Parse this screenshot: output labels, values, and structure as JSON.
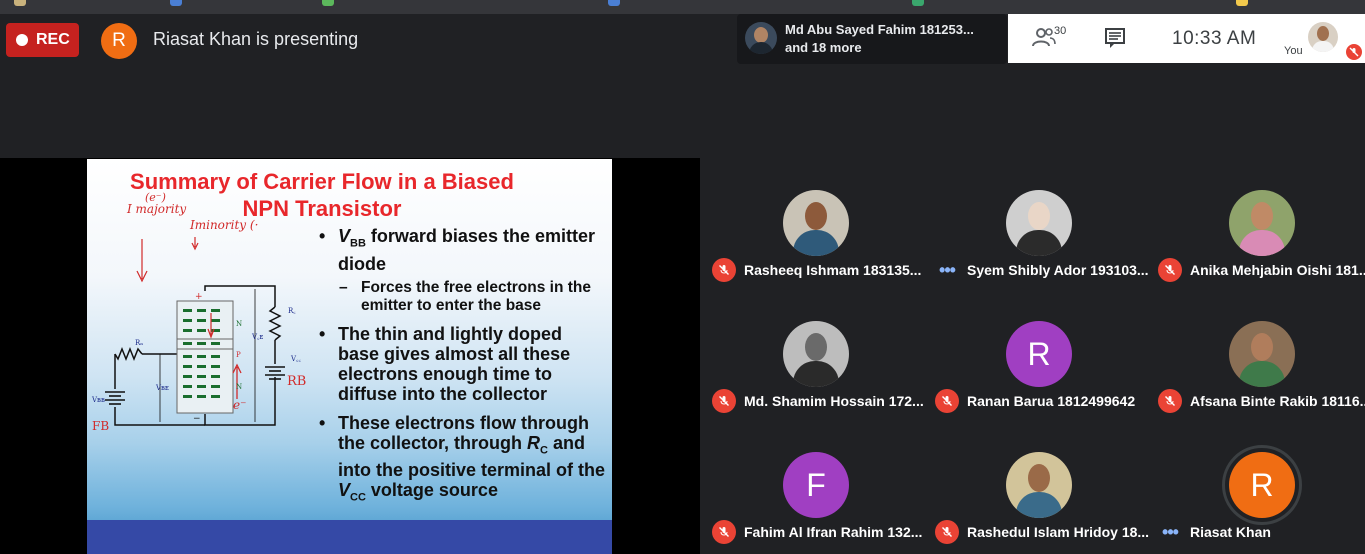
{
  "recording": {
    "label": "REC"
  },
  "presenter": {
    "initial": "R",
    "text": "Riasat Khan is presenting"
  },
  "attendee_chip": {
    "line1": "Md Abu Sayed Fahim 181253...",
    "line2": "and 18 more"
  },
  "toolbar": {
    "people_count": "30",
    "time": "10:33  AM",
    "you_label": "You"
  },
  "slide": {
    "title_line1": "Summary of Carrier Flow in a Biased",
    "title_line2": "NPN Transistor",
    "bullets": [
      {
        "pre": "",
        "sym": "V",
        "sub": "BB",
        "text": " forward biases the emitter diode"
      },
      {
        "text": "The thin and lightly doped base gives almost all these electrons enough time to diffuse into the collector"
      },
      {
        "text_a": "These electrons flow through the collector, through ",
        "sym": "R",
        "sub": "C",
        "text_b": " and into the positive terminal of the ",
        "sym2": "V",
        "sub2": "CC",
        "text_c": " voltage source"
      }
    ],
    "sub_bullet": "Forces the free electrons in the emitter to enter the base",
    "annotations": {
      "e": "(e⁻)",
      "i_majority": "I majority",
      "i_minority": "Iminority (·",
      "fb": "FB",
      "rb": "RB",
      "e_minus": "e⁻"
    },
    "circuit_labels": {
      "plus": "+",
      "minus": "−",
      "n_top": "N",
      "p": "P",
      "n_bot": "N",
      "rb": "Rₙ",
      "rc": "R꜀",
      "vbb": "Vʙʙ",
      "vbe": "Vʙᴇ",
      "vce": "V꜀ᴇ",
      "vcc": "V꜀꜀"
    }
  },
  "participants": [
    {
      "name": "Rasheeq Ishmam 183135...",
      "status": "muted",
      "avatar": "photo",
      "skin": "#8d5a3b",
      "shirt": "#2f5a7a",
      "bg": "#c9c3b6"
    },
    {
      "name": "Syem Shibly Ador 193103...",
      "status": "more",
      "avatar": "photo",
      "skin": "#e9d6c7",
      "shirt": "#2b2b2b",
      "bg": "#cfcfcf"
    },
    {
      "name": "Anika Mehjabin Oishi 181...",
      "status": "muted",
      "avatar": "photo",
      "skin": "#c08a66",
      "shirt": "#d98bb5",
      "bg": "#8fa36b"
    },
    {
      "name": "Md. Shamim Hossain 172...",
      "status": "muted",
      "avatar": "photo",
      "skin": "#6a6a6a",
      "shirt": "#2a2a2a",
      "bg": "#bdbdbd"
    },
    {
      "name": "Ranan Barua 1812499642",
      "status": "muted",
      "avatar": "letter",
      "initial": "R",
      "bg": "#a03fc2"
    },
    {
      "name": "Afsana Binte Rakib 18116...",
      "status": "muted",
      "avatar": "photo",
      "skin": "#b07d5c",
      "shirt": "#3f7a4a",
      "bg": "#8a6f55"
    },
    {
      "name": "Fahim Al Ifran Rahim 132...",
      "status": "muted",
      "avatar": "letter",
      "initial": "F",
      "bg": "#a03fc2"
    },
    {
      "name": "Rashedul Islam Hridoy 18...",
      "status": "muted",
      "avatar": "photo",
      "skin": "#9a6a48",
      "shirt": "#3a6b8a",
      "bg": "#d2c49a"
    },
    {
      "name": "Riasat Khan",
      "status": "more",
      "avatar": "letter",
      "initial": "R",
      "bg": "#f06d13",
      "presenting": true
    }
  ]
}
